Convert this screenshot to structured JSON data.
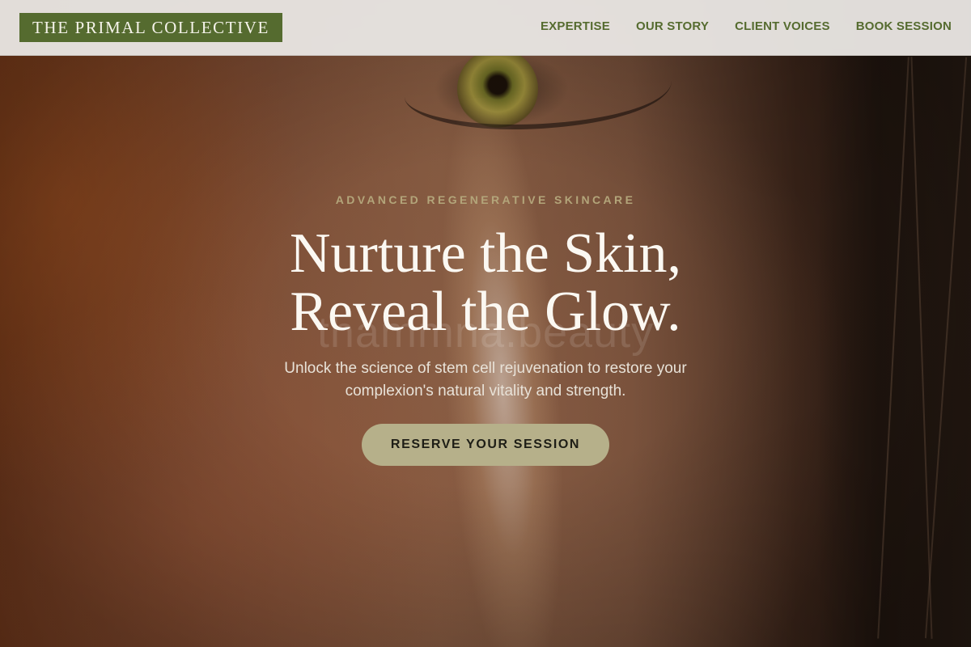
{
  "header": {
    "logo_text": "THE PRIMAL COLLECTIVE",
    "nav": [
      {
        "label": "EXPERTISE"
      },
      {
        "label": "OUR STORY"
      },
      {
        "label": "CLIENT VOICES"
      },
      {
        "label": "BOOK SESSION"
      }
    ]
  },
  "hero": {
    "eyebrow": "ADVANCED REGENERATIVE SKINCARE",
    "headline_line1": "Nurture the Skin,",
    "headline_line2": "Reveal the Glow.",
    "watermark": "thammna.beauty",
    "subtext_line1": "Unlock the science of stem cell rejuvenation to restore your",
    "subtext_line2": "complexion's natural vitality and strength.",
    "cta_label": "RESERVE YOUR SESSION"
  },
  "colors": {
    "brand_green": "#556b2f",
    "cta_bg": "#b6b08a",
    "eyebrow": "#b3a57a",
    "header_bg": "#e8e5e2"
  }
}
